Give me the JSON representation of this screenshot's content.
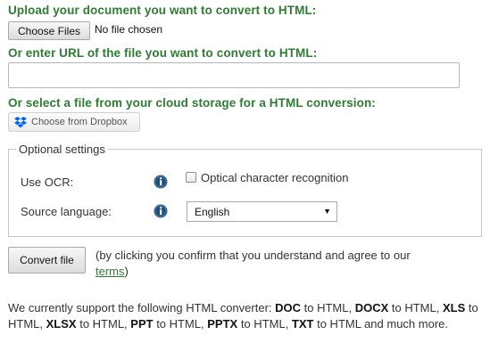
{
  "upload": {
    "heading": "Upload your document you want to convert to HTML:",
    "choose_files_label": "Choose Files",
    "no_file_text": "No file chosen"
  },
  "url": {
    "heading": "Or enter URL of the file you want to convert to HTML:",
    "value": ""
  },
  "cloud": {
    "heading": "Or select a file from your cloud storage for a HTML conversion:",
    "dropbox_label": "Choose from Dropbox"
  },
  "optional": {
    "legend": "Optional settings",
    "ocr_label": "Use OCR:",
    "ocr_checkbox_label": "Optical character recognition",
    "ocr_checked": false,
    "language_label": "Source language:",
    "language_selected": "English",
    "dropdown_arrow": "▼"
  },
  "convert": {
    "button_label": "Convert file",
    "confirm_before": "(by clicking you confirm that you understand and agree to our ",
    "terms_link": "terms",
    "confirm_after": ")"
  },
  "support": {
    "intro": "We currently support the following HTML converter: ",
    "formats": [
      {
        "name": "DOC",
        "suffix": " to HTML, "
      },
      {
        "name": "DOCX",
        "suffix": " to HTML, "
      },
      {
        "name": "XLS",
        "suffix": " to HTML, "
      },
      {
        "name": "XLSX",
        "suffix": " to HTML, "
      },
      {
        "name": "PPT",
        "suffix": " to HTML, "
      },
      {
        "name": "PPTX",
        "suffix": " to HTML, "
      },
      {
        "name": "TXT",
        "suffix": " to HTML and much more."
      }
    ]
  },
  "colors": {
    "heading_green": "#2e7d32",
    "dropbox_blue": "#0061fe",
    "info_navy": "#1f4e79"
  },
  "icons": {
    "dropbox": "dropbox-icon",
    "info": "info-icon"
  }
}
